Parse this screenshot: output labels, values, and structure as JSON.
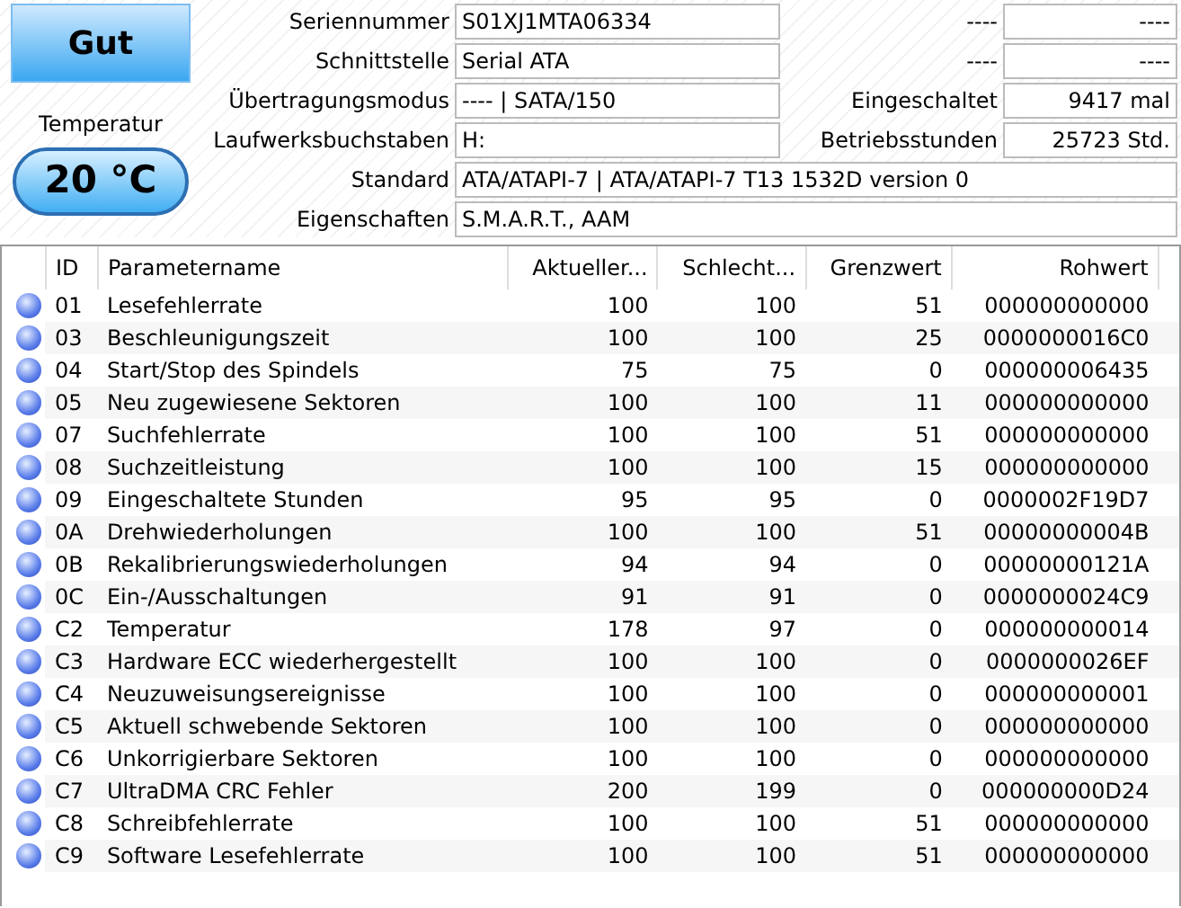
{
  "status": {
    "label": "Gut"
  },
  "temperature": {
    "label": "Temperatur",
    "value": "20 °C"
  },
  "info_rows": [
    {
      "label": "Seriennummer",
      "value": "S01XJ1MTA06334",
      "right_label": "----",
      "right_value": "----"
    },
    {
      "label": "Schnittstelle",
      "value": "Serial ATA",
      "right_label": "----",
      "right_value": "----"
    },
    {
      "label": "Übertragungsmodus",
      "value": "---- | SATA/150",
      "right_label": "Eingeschaltet",
      "right_value": "9417 mal"
    },
    {
      "label": "Laufwerksbuchstaben",
      "value": "H:",
      "right_label": "Betriebsstunden",
      "right_value": "25723 Std."
    },
    {
      "label": "Standard",
      "value": "ATA/ATAPI-7 | ATA/ATAPI-7 T13 1532D version 0"
    },
    {
      "label": "Eigenschaften",
      "value": "S.M.A.R.T., AAM"
    }
  ],
  "table": {
    "columns": [
      "ID",
      "Parametername",
      "Aktueller...",
      "Schlecht...",
      "Grenzwert",
      "Rohwert"
    ],
    "rows": [
      [
        "01",
        "Lesefehlerrate",
        "100",
        "100",
        "51",
        "000000000000"
      ],
      [
        "03",
        "Beschleunigungszeit",
        "100",
        "100",
        "25",
        "0000000016C0"
      ],
      [
        "04",
        "Start/Stop des Spindels",
        "75",
        "75",
        "0",
        "000000006435"
      ],
      [
        "05",
        "Neu zugewiesene Sektoren",
        "100",
        "100",
        "11",
        "000000000000"
      ],
      [
        "07",
        "Suchfehlerrate",
        "100",
        "100",
        "51",
        "000000000000"
      ],
      [
        "08",
        "Suchzeitleistung",
        "100",
        "100",
        "15",
        "000000000000"
      ],
      [
        "09",
        "Eingeschaltete Stunden",
        "95",
        "95",
        "0",
        "0000002F19D7"
      ],
      [
        "0A",
        "Drehwiederholungen",
        "100",
        "100",
        "51",
        "00000000004B"
      ],
      [
        "0B",
        "Rekalibrierungswiederholungen",
        "94",
        "94",
        "0",
        "00000000121A"
      ],
      [
        "0C",
        "Ein-/Ausschaltungen",
        "91",
        "91",
        "0",
        "0000000024C9"
      ],
      [
        "C2",
        "Temperatur",
        "178",
        "97",
        "0",
        "000000000014"
      ],
      [
        "C3",
        "Hardware ECC wiederhergestellt",
        "100",
        "100",
        "0",
        "0000000026EF"
      ],
      [
        "C4",
        "Neuzuweisungsereignisse",
        "100",
        "100",
        "0",
        "000000000001"
      ],
      [
        "C5",
        "Aktuell schwebende Sektoren",
        "100",
        "100",
        "0",
        "000000000000"
      ],
      [
        "C6",
        "Unkorrigierbare Sektoren",
        "100",
        "100",
        "0",
        "000000000000"
      ],
      [
        "C7",
        "UltraDMA CRC Fehler",
        "200",
        "199",
        "0",
        "000000000D24"
      ],
      [
        "C8",
        "Schreibfehlerrate",
        "100",
        "100",
        "51",
        "000000000000"
      ],
      [
        "C9",
        "Software Lesefehlerrate",
        "100",
        "100",
        "51",
        "000000000000"
      ]
    ]
  }
}
